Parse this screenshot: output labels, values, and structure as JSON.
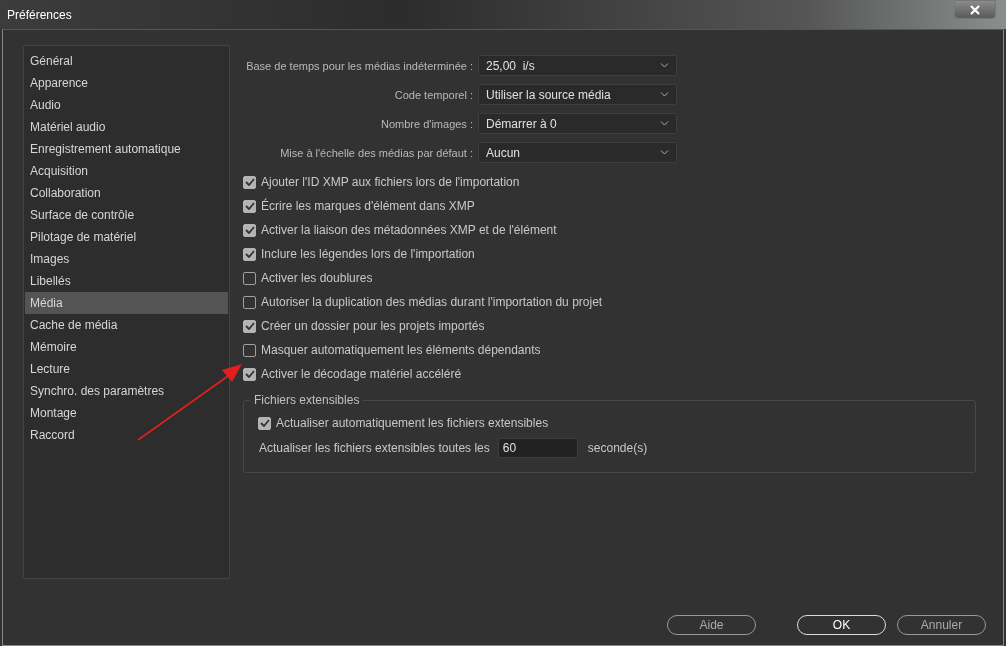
{
  "window": {
    "title": "Préférences"
  },
  "sidebar": {
    "items": [
      {
        "label": "Général",
        "selected": false
      },
      {
        "label": "Apparence",
        "selected": false
      },
      {
        "label": "Audio",
        "selected": false
      },
      {
        "label": "Matériel audio",
        "selected": false
      },
      {
        "label": "Enregistrement automatique",
        "selected": false
      },
      {
        "label": "Acquisition",
        "selected": false
      },
      {
        "label": "Collaboration",
        "selected": false
      },
      {
        "label": "Surface de contrôle",
        "selected": false
      },
      {
        "label": "Pilotage de matériel",
        "selected": false
      },
      {
        "label": "Images",
        "selected": false
      },
      {
        "label": "Libellés",
        "selected": false
      },
      {
        "label": "Média",
        "selected": true
      },
      {
        "label": "Cache de média",
        "selected": false
      },
      {
        "label": "Mémoire",
        "selected": false
      },
      {
        "label": "Lecture",
        "selected": false
      },
      {
        "label": "Synchro. des paramètres",
        "selected": false
      },
      {
        "label": "Montage",
        "selected": false
      },
      {
        "label": "Raccord",
        "selected": false
      }
    ]
  },
  "dropdowns": [
    {
      "label": "Base de temps pour les médias indéterminée :",
      "value": "25,00  i/s"
    },
    {
      "label": "Code temporel :",
      "value": "Utiliser la source média"
    },
    {
      "label": "Nombre d'images :",
      "value": "Démarrer à 0"
    },
    {
      "label": "Mise à l'échelle des médias par défaut :",
      "value": "Aucun"
    }
  ],
  "checkboxes": [
    {
      "label": "Ajouter l'ID XMP aux fichiers lors de l'importation",
      "checked": true
    },
    {
      "label": "Écrire les marques d'élément dans XMP",
      "checked": true
    },
    {
      "label": "Activer la liaison des métadonnées XMP et de l'élément",
      "checked": true
    },
    {
      "label": "Inclure les légendes lors de l'importation",
      "checked": true
    },
    {
      "label": "Activer les doublures",
      "checked": false
    },
    {
      "label": "Autoriser la duplication des médias durant l'importation du projet",
      "checked": false
    },
    {
      "label": "Créer un dossier pour les projets importés",
      "checked": true
    },
    {
      "label": "Masquer automatiquement les éléments dépendants",
      "checked": false
    },
    {
      "label": "Activer le décodage matériel accéléré",
      "checked": true
    }
  ],
  "group": {
    "title": "Fichiers extensibles",
    "checkbox": {
      "label": "Actualiser automatiquement les fichiers extensibles",
      "checked": true
    },
    "interval": {
      "label": "Actualiser les fichiers extensibles toutes les",
      "value": "60",
      "unit": "seconde(s)"
    }
  },
  "buttons": [
    {
      "label": "Aide",
      "default": false
    },
    {
      "label": "OK",
      "default": true
    },
    {
      "label": "Annuler",
      "default": false
    }
  ]
}
